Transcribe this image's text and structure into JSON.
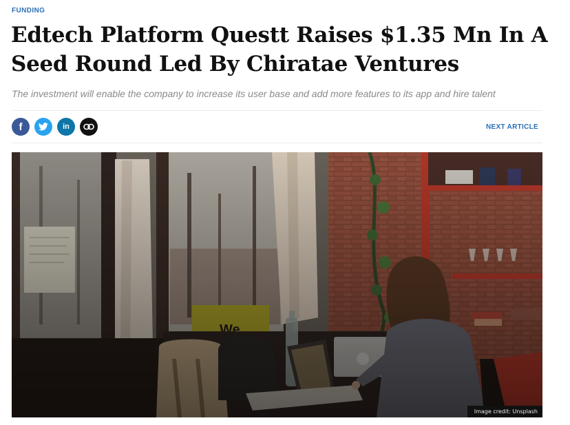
{
  "article": {
    "category": "FUNDING",
    "headline": "Edtech Platform Questt Raises $1.35 Mn In A Seed Round Led By Chiratae Ventures",
    "subtitle": "The investment will enable the company to increase its user base and add more features to its app and hire talent"
  },
  "share": {
    "buttons": [
      {
        "icon": "facebook-icon",
        "glyph": "f",
        "color": "#3b5998"
      },
      {
        "icon": "twitter-icon",
        "color": "#2aa3ef"
      },
      {
        "icon": "linkedin-icon",
        "glyph": "in",
        "color": "#0e76a8"
      },
      {
        "icon": "link-icon",
        "color": "#111111"
      }
    ]
  },
  "nav": {
    "next_article_label": "NEXT ARTICLE"
  },
  "hero_image": {
    "sign_text": "We",
    "credit": "Image credit: Unsplash"
  },
  "colors": {
    "accent": "#2a6fb5",
    "headline": "#111111",
    "subtitle": "#8a8a8a"
  }
}
